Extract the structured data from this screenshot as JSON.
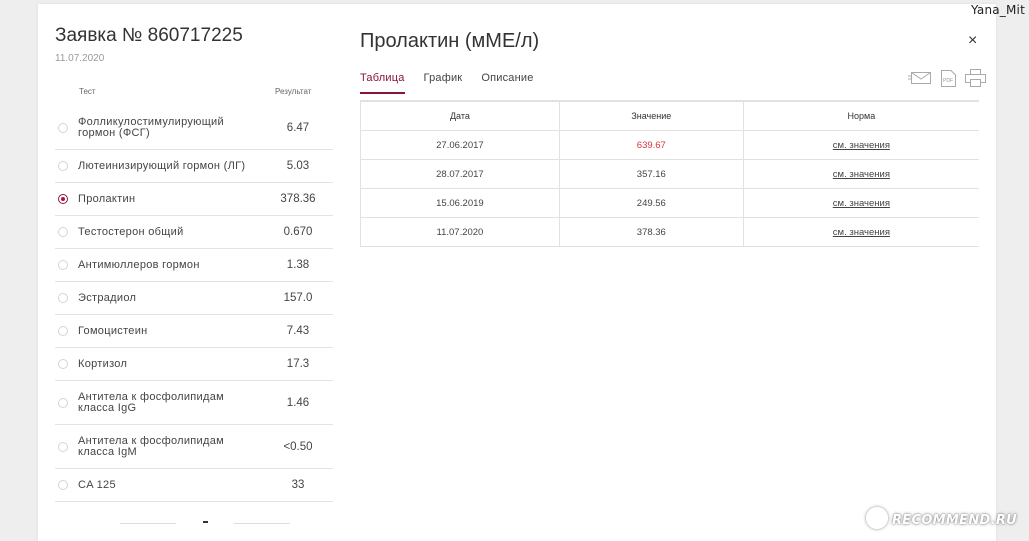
{
  "watermark": {
    "user": "Yana_Mit",
    "site": "RECOMMEND.RU"
  },
  "request": {
    "title": "Заявка № 860717225",
    "date": "11.07.2020"
  },
  "left_table": {
    "col_test": "Тест",
    "col_result": "Результат",
    "rows": [
      {
        "name": "Фолликулостимулирующий гормон (ФСГ)",
        "value": "6.47",
        "selected": false
      },
      {
        "name": "Лютеинизирующий гормон (ЛГ)",
        "value": "5.03",
        "selected": false
      },
      {
        "name": "Пролактин",
        "value": "378.36",
        "selected": true
      },
      {
        "name": "Тестостерон общий",
        "value": "0.670",
        "selected": false
      },
      {
        "name": "Антимюллеров гормон",
        "value": "1.38",
        "selected": false
      },
      {
        "name": "Эстрадиол",
        "value": "157.0",
        "selected": false
      },
      {
        "name": "Гомоцистеин",
        "value": "7.43",
        "selected": false
      },
      {
        "name": "Кортизол",
        "value": "17.3",
        "selected": false
      },
      {
        "name": "Антитела к фосфолипидам класса IgG",
        "value": "1.46",
        "selected": false
      },
      {
        "name": "Антитела к фосфолипидам класса IgM",
        "value": "<0.50",
        "selected": false
      },
      {
        "name": "CA 125",
        "value": "33",
        "selected": false
      }
    ]
  },
  "detail": {
    "title": "Пролактин (мМЕ/л)",
    "close_symbol": "×",
    "tabs": [
      {
        "label": "Таблица",
        "active": true
      },
      {
        "label": "График",
        "active": false
      },
      {
        "label": "Описание",
        "active": false
      }
    ],
    "icons": [
      "envelope-icon",
      "pdf-icon",
      "printer-icon"
    ],
    "pdf_icon_text": "PDF",
    "table": {
      "headers": [
        "Дата",
        "Значение",
        "Норма"
      ],
      "rows": [
        {
          "date": "27.06.2017",
          "value": "639.67",
          "norm": "см. значения",
          "out_of_range": true
        },
        {
          "date": "28.07.2017",
          "value": "357.16",
          "norm": "см. значения",
          "out_of_range": false
        },
        {
          "date": "15.06.2019",
          "value": "249.56",
          "norm": "см. значения",
          "out_of_range": false
        },
        {
          "date": "11.07.2020",
          "value": "378.36",
          "norm": "см. значения",
          "out_of_range": false
        }
      ]
    }
  },
  "colors": {
    "accent": "#8a1538",
    "out_of_range": "#d9353b"
  }
}
